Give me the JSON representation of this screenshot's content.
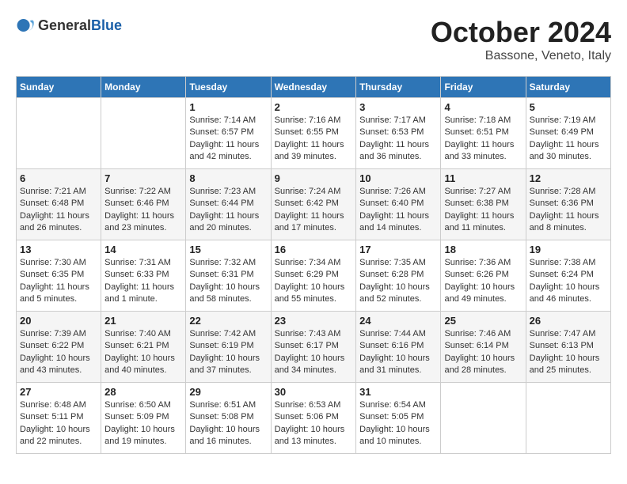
{
  "header": {
    "logo_general": "General",
    "logo_blue": "Blue",
    "month": "October 2024",
    "location": "Bassone, Veneto, Italy"
  },
  "days_of_week": [
    "Sunday",
    "Monday",
    "Tuesday",
    "Wednesday",
    "Thursday",
    "Friday",
    "Saturday"
  ],
  "weeks": [
    [
      {
        "day": "",
        "sunrise": "",
        "sunset": "",
        "daylight": ""
      },
      {
        "day": "",
        "sunrise": "",
        "sunset": "",
        "daylight": ""
      },
      {
        "day": "1",
        "sunrise": "Sunrise: 7:14 AM",
        "sunset": "Sunset: 6:57 PM",
        "daylight": "Daylight: 11 hours and 42 minutes."
      },
      {
        "day": "2",
        "sunrise": "Sunrise: 7:16 AM",
        "sunset": "Sunset: 6:55 PM",
        "daylight": "Daylight: 11 hours and 39 minutes."
      },
      {
        "day": "3",
        "sunrise": "Sunrise: 7:17 AM",
        "sunset": "Sunset: 6:53 PM",
        "daylight": "Daylight: 11 hours and 36 minutes."
      },
      {
        "day": "4",
        "sunrise": "Sunrise: 7:18 AM",
        "sunset": "Sunset: 6:51 PM",
        "daylight": "Daylight: 11 hours and 33 minutes."
      },
      {
        "day": "5",
        "sunrise": "Sunrise: 7:19 AM",
        "sunset": "Sunset: 6:49 PM",
        "daylight": "Daylight: 11 hours and 30 minutes."
      }
    ],
    [
      {
        "day": "6",
        "sunrise": "Sunrise: 7:21 AM",
        "sunset": "Sunset: 6:48 PM",
        "daylight": "Daylight: 11 hours and 26 minutes."
      },
      {
        "day": "7",
        "sunrise": "Sunrise: 7:22 AM",
        "sunset": "Sunset: 6:46 PM",
        "daylight": "Daylight: 11 hours and 23 minutes."
      },
      {
        "day": "8",
        "sunrise": "Sunrise: 7:23 AM",
        "sunset": "Sunset: 6:44 PM",
        "daylight": "Daylight: 11 hours and 20 minutes."
      },
      {
        "day": "9",
        "sunrise": "Sunrise: 7:24 AM",
        "sunset": "Sunset: 6:42 PM",
        "daylight": "Daylight: 11 hours and 17 minutes."
      },
      {
        "day": "10",
        "sunrise": "Sunrise: 7:26 AM",
        "sunset": "Sunset: 6:40 PM",
        "daylight": "Daylight: 11 hours and 14 minutes."
      },
      {
        "day": "11",
        "sunrise": "Sunrise: 7:27 AM",
        "sunset": "Sunset: 6:38 PM",
        "daylight": "Daylight: 11 hours and 11 minutes."
      },
      {
        "day": "12",
        "sunrise": "Sunrise: 7:28 AM",
        "sunset": "Sunset: 6:36 PM",
        "daylight": "Daylight: 11 hours and 8 minutes."
      }
    ],
    [
      {
        "day": "13",
        "sunrise": "Sunrise: 7:30 AM",
        "sunset": "Sunset: 6:35 PM",
        "daylight": "Daylight: 11 hours and 5 minutes."
      },
      {
        "day": "14",
        "sunrise": "Sunrise: 7:31 AM",
        "sunset": "Sunset: 6:33 PM",
        "daylight": "Daylight: 11 hours and 1 minute."
      },
      {
        "day": "15",
        "sunrise": "Sunrise: 7:32 AM",
        "sunset": "Sunset: 6:31 PM",
        "daylight": "Daylight: 10 hours and 58 minutes."
      },
      {
        "day": "16",
        "sunrise": "Sunrise: 7:34 AM",
        "sunset": "Sunset: 6:29 PM",
        "daylight": "Daylight: 10 hours and 55 minutes."
      },
      {
        "day": "17",
        "sunrise": "Sunrise: 7:35 AM",
        "sunset": "Sunset: 6:28 PM",
        "daylight": "Daylight: 10 hours and 52 minutes."
      },
      {
        "day": "18",
        "sunrise": "Sunrise: 7:36 AM",
        "sunset": "Sunset: 6:26 PM",
        "daylight": "Daylight: 10 hours and 49 minutes."
      },
      {
        "day": "19",
        "sunrise": "Sunrise: 7:38 AM",
        "sunset": "Sunset: 6:24 PM",
        "daylight": "Daylight: 10 hours and 46 minutes."
      }
    ],
    [
      {
        "day": "20",
        "sunrise": "Sunrise: 7:39 AM",
        "sunset": "Sunset: 6:22 PM",
        "daylight": "Daylight: 10 hours and 43 minutes."
      },
      {
        "day": "21",
        "sunrise": "Sunrise: 7:40 AM",
        "sunset": "Sunset: 6:21 PM",
        "daylight": "Daylight: 10 hours and 40 minutes."
      },
      {
        "day": "22",
        "sunrise": "Sunrise: 7:42 AM",
        "sunset": "Sunset: 6:19 PM",
        "daylight": "Daylight: 10 hours and 37 minutes."
      },
      {
        "day": "23",
        "sunrise": "Sunrise: 7:43 AM",
        "sunset": "Sunset: 6:17 PM",
        "daylight": "Daylight: 10 hours and 34 minutes."
      },
      {
        "day": "24",
        "sunrise": "Sunrise: 7:44 AM",
        "sunset": "Sunset: 6:16 PM",
        "daylight": "Daylight: 10 hours and 31 minutes."
      },
      {
        "day": "25",
        "sunrise": "Sunrise: 7:46 AM",
        "sunset": "Sunset: 6:14 PM",
        "daylight": "Daylight: 10 hours and 28 minutes."
      },
      {
        "day": "26",
        "sunrise": "Sunrise: 7:47 AM",
        "sunset": "Sunset: 6:13 PM",
        "daylight": "Daylight: 10 hours and 25 minutes."
      }
    ],
    [
      {
        "day": "27",
        "sunrise": "Sunrise: 6:48 AM",
        "sunset": "Sunset: 5:11 PM",
        "daylight": "Daylight: 10 hours and 22 minutes."
      },
      {
        "day": "28",
        "sunrise": "Sunrise: 6:50 AM",
        "sunset": "Sunset: 5:09 PM",
        "daylight": "Daylight: 10 hours and 19 minutes."
      },
      {
        "day": "29",
        "sunrise": "Sunrise: 6:51 AM",
        "sunset": "Sunset: 5:08 PM",
        "daylight": "Daylight: 10 hours and 16 minutes."
      },
      {
        "day": "30",
        "sunrise": "Sunrise: 6:53 AM",
        "sunset": "Sunset: 5:06 PM",
        "daylight": "Daylight: 10 hours and 13 minutes."
      },
      {
        "day": "31",
        "sunrise": "Sunrise: 6:54 AM",
        "sunset": "Sunset: 5:05 PM",
        "daylight": "Daylight: 10 hours and 10 minutes."
      },
      {
        "day": "",
        "sunrise": "",
        "sunset": "",
        "daylight": ""
      },
      {
        "day": "",
        "sunrise": "",
        "sunset": "",
        "daylight": ""
      }
    ]
  ]
}
